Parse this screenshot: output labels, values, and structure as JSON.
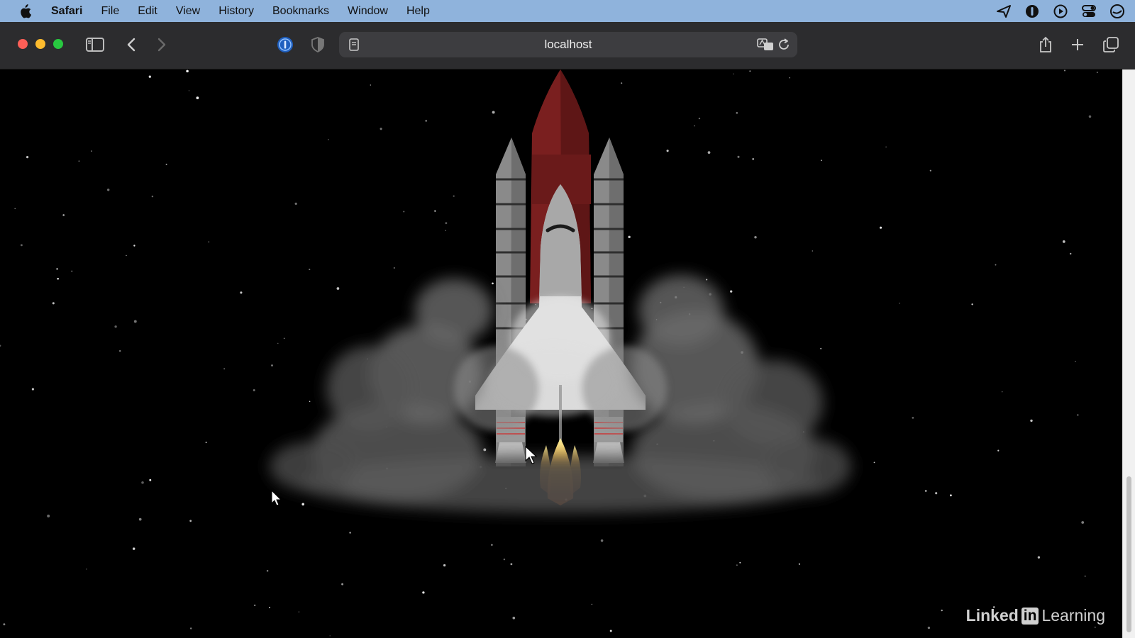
{
  "menubar": {
    "app_name": "Safari",
    "items": [
      "File",
      "Edit",
      "View",
      "History",
      "Bookmarks",
      "Window",
      "Help"
    ]
  },
  "toolbar": {
    "url": "localhost"
  },
  "watermark": {
    "brand_left": "Linked",
    "brand_badge": "in",
    "brand_right": "Learning"
  },
  "scene": {
    "background_color": "#000000",
    "rocket_nose_color": "#7a1f1f",
    "booster_color": "#8a8a8a",
    "shuttle_color": "#d9d9d9",
    "flame_color": "#f0a020",
    "smoke_color": "#6a6a6a"
  }
}
